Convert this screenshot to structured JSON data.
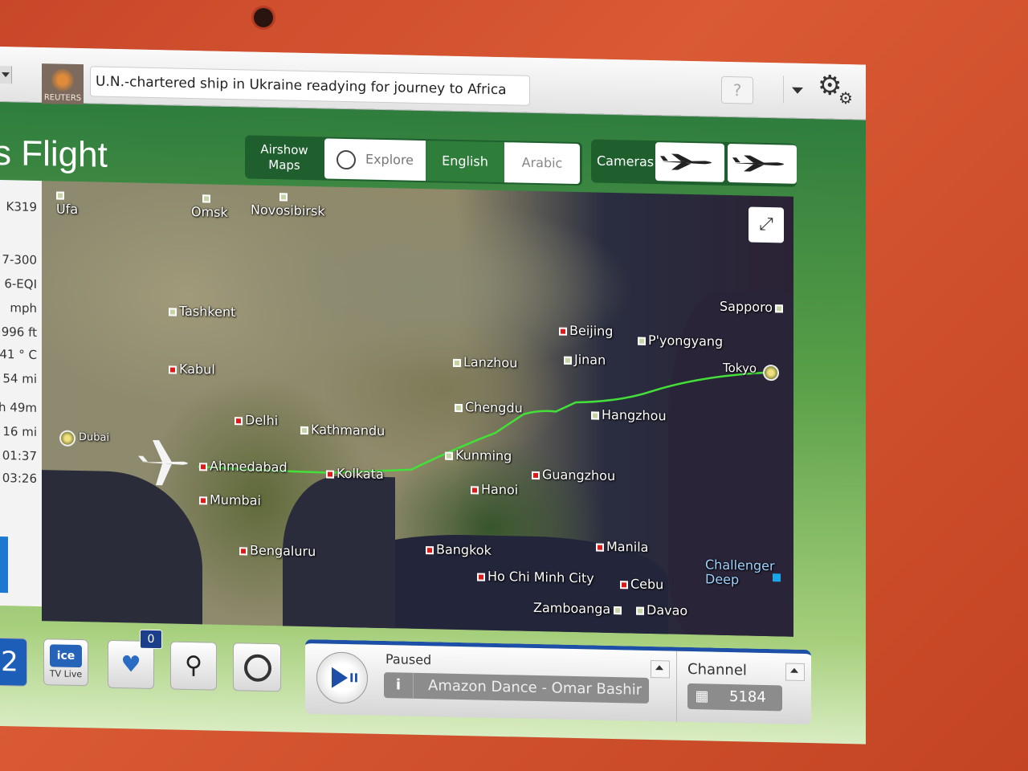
{
  "news": {
    "source": "REUTERS",
    "headline": "U.N.-chartered ship in Ukraine readying for journey to Africa",
    "help_label": "?"
  },
  "header": {
    "title": "s Flight"
  },
  "view_tabs": {
    "airshow_line1": "Airshow",
    "airshow_line2": "Maps",
    "explore": "Explore",
    "english": "English",
    "arabic": "Arabic"
  },
  "cameras": {
    "label": "Cameras"
  },
  "side_info": [
    "K319",
    "7-300",
    "6-EQI",
    "mph",
    "996 ft",
    "41 ° C",
    "54 mi",
    "h 49m",
    "16 mi",
    "01:37",
    "03:26"
  ],
  "map": {
    "expand_icon": "expand-icon",
    "cities": [
      {
        "name": "Ufa",
        "type": "green"
      },
      {
        "name": "Omsk",
        "type": "green"
      },
      {
        "name": "Novosibirsk",
        "type": "green"
      },
      {
        "name": "Tashkent",
        "type": "green"
      },
      {
        "name": "Kabul",
        "type": "red"
      },
      {
        "name": "Delhi",
        "type": "red"
      },
      {
        "name": "Kathmandu",
        "type": "green"
      },
      {
        "name": "Dubai",
        "type": "airport"
      },
      {
        "name": "Ahmedabad",
        "type": "red"
      },
      {
        "name": "Kolkata",
        "type": "red"
      },
      {
        "name": "Mumbai",
        "type": "red"
      },
      {
        "name": "Bengaluru",
        "type": "red"
      },
      {
        "name": "Lanzhou",
        "type": "green"
      },
      {
        "name": "Chengdu",
        "type": "green"
      },
      {
        "name": "Kunming",
        "type": "green"
      },
      {
        "name": "Beijing",
        "type": "red"
      },
      {
        "name": "Jinan",
        "type": "green"
      },
      {
        "name": "P'yongyang",
        "type": "green"
      },
      {
        "name": "Sapporo",
        "type": "green"
      },
      {
        "name": "Tokyo",
        "type": "airport"
      },
      {
        "name": "Hangzhou",
        "type": "green"
      },
      {
        "name": "Guangzhou",
        "type": "red"
      },
      {
        "name": "Hanoi",
        "type": "red"
      },
      {
        "name": "Bangkok",
        "type": "red"
      },
      {
        "name": "Ho Chi Minh City",
        "type": "red"
      },
      {
        "name": "Manila",
        "type": "red"
      },
      {
        "name": "Cebu",
        "type": "red"
      },
      {
        "name": "Zamboanga",
        "type": "green"
      },
      {
        "name": "Davao",
        "type": "green"
      },
      {
        "name": "Challenger",
        "type": "blue-label"
      },
      {
        "name": "Deep",
        "type": "blue-label"
      }
    ],
    "route_color": "#44e03a"
  },
  "bottom": {
    "ice_label": "ice",
    "ice_sub": "TV Live",
    "favorites_count": "0"
  },
  "player": {
    "status": "Paused",
    "info_icon": "i",
    "track": "Amazon Dance - Omar Bashir",
    "channel_label": "Channel",
    "channel": "5184"
  }
}
